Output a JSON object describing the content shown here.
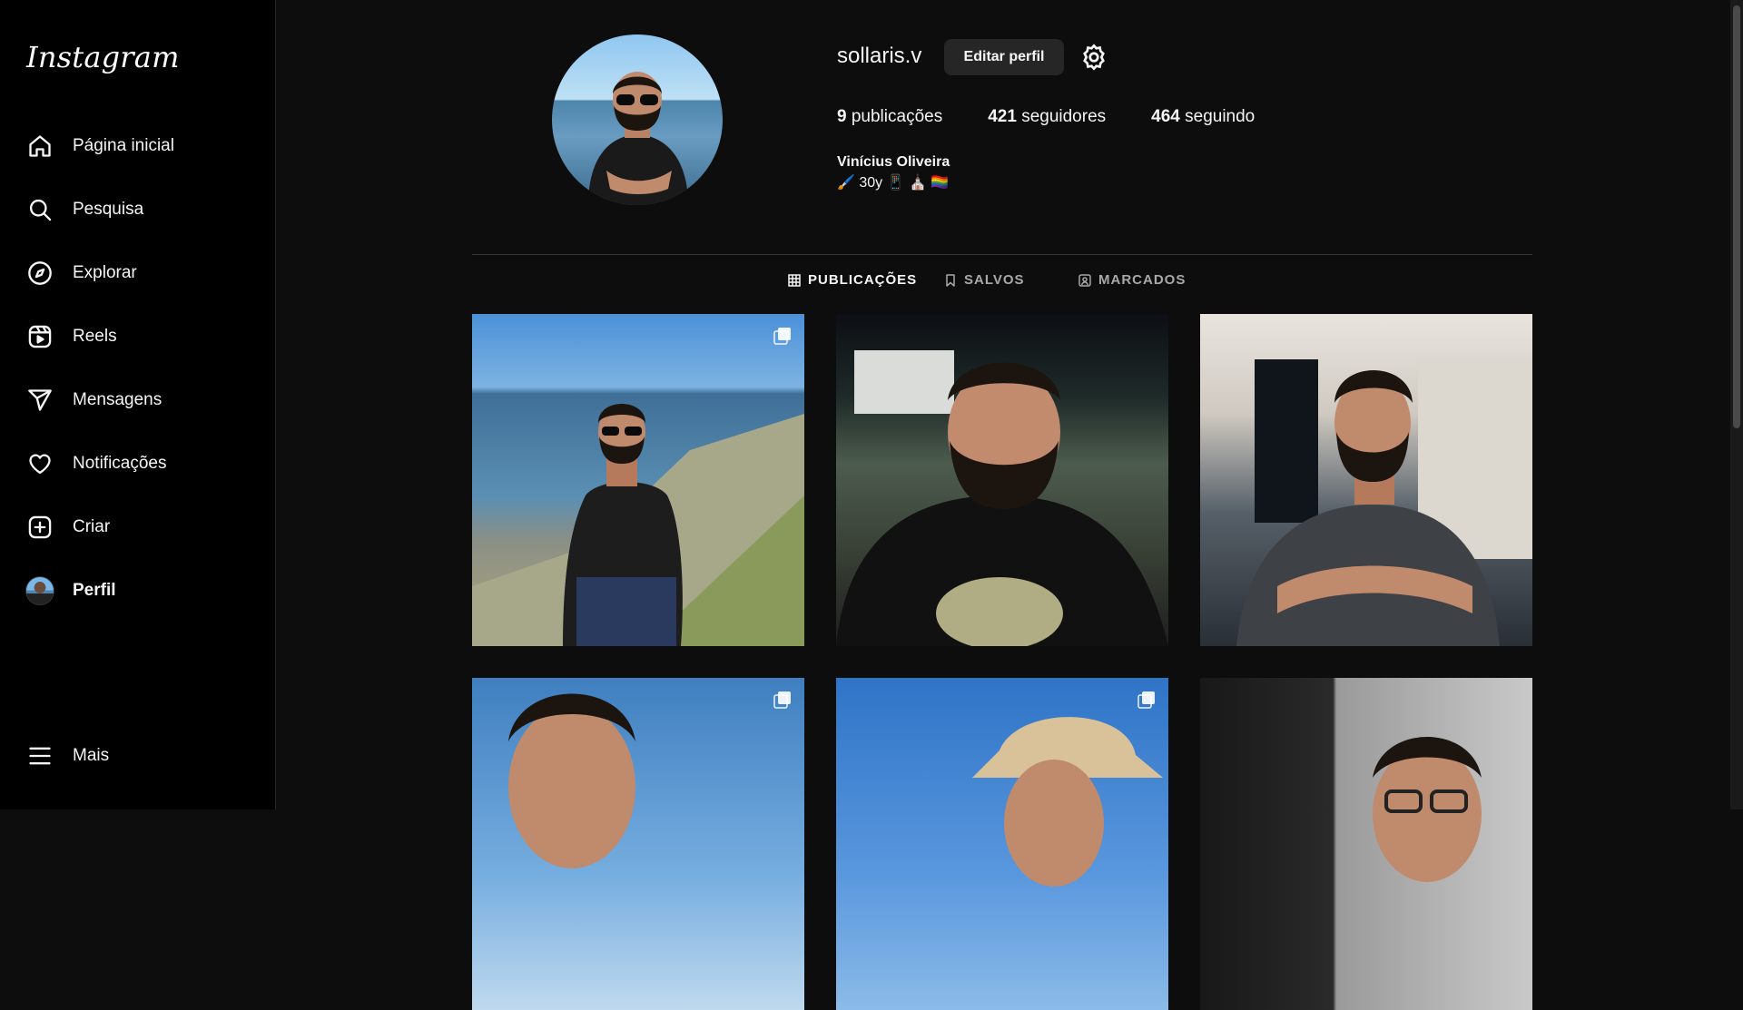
{
  "brand": {
    "logo_text": "Instagram"
  },
  "sidebar": {
    "items": [
      {
        "label": "Página inicial",
        "icon": "home-icon"
      },
      {
        "label": "Pesquisa",
        "icon": "search-icon"
      },
      {
        "label": "Explorar",
        "icon": "compass-icon"
      },
      {
        "label": "Reels",
        "icon": "reels-icon"
      },
      {
        "label": "Mensagens",
        "icon": "send-icon"
      },
      {
        "label": "Notificações",
        "icon": "heart-icon"
      },
      {
        "label": "Criar",
        "icon": "plus-square-icon"
      },
      {
        "label": "Perfil",
        "icon": "avatar-icon",
        "active": true
      }
    ],
    "more_label": "Mais"
  },
  "profile": {
    "username": "sollaris.v",
    "edit_button": "Editar perfil",
    "stats": {
      "posts_count": "9",
      "posts_label": "publicações",
      "followers_count": "421",
      "followers_label": "seguidores",
      "following_count": "464",
      "following_label": "seguindo"
    },
    "full_name": "Vinícius Oliveira",
    "bio": "🖌️ 30y 📱 ⛪ 🏳️‍🌈"
  },
  "tabs": [
    {
      "label": "PUBLICAÇÕES",
      "active": true,
      "icon": "grid-icon"
    },
    {
      "label": "SALVOS",
      "active": false,
      "icon": "bookmark-icon"
    },
    {
      "label": "MARCADOS",
      "active": false,
      "icon": "tagged-icon"
    }
  ],
  "posts": [
    {
      "scene": "sea-rocks",
      "multi": true
    },
    {
      "scene": "night-selfie",
      "multi": false
    },
    {
      "scene": "studio",
      "multi": false
    },
    {
      "scene": "beach-selfie",
      "multi": true
    },
    {
      "scene": "hat-beach",
      "multi": true
    },
    {
      "scene": "studio-glasses",
      "multi": false
    }
  ],
  "colors": {
    "background": "#0d0d0d",
    "sidebar": "#000000",
    "button": "#262626",
    "muted": "#a8a8a8"
  }
}
